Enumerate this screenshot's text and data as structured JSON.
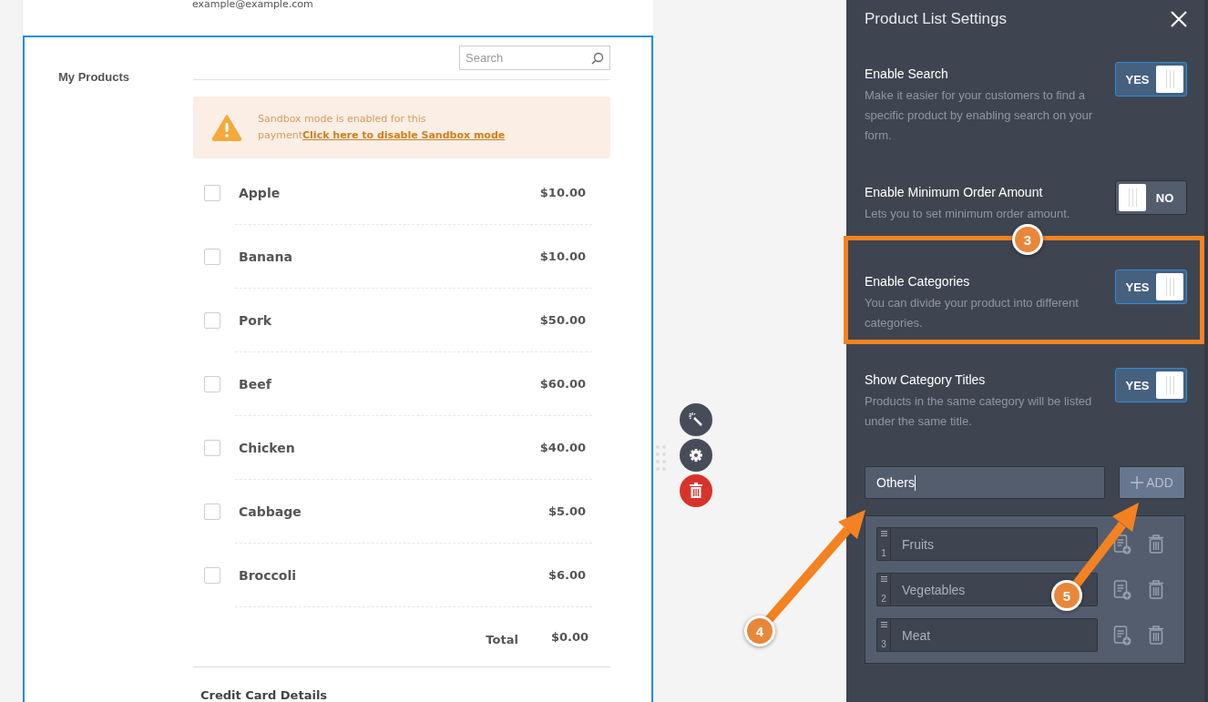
{
  "form": {
    "email": "example@example.com",
    "field_label": "My Products",
    "search": {
      "placeholder": "Search"
    },
    "notice": {
      "text": "Sandbox mode is enabled for this payment",
      "link": "Click here to disable Sandbox mode"
    },
    "products": [
      {
        "name": "Apple",
        "price": "$10.00",
        "checked": false
      },
      {
        "name": "Banana",
        "price": "$10.00",
        "checked": false
      },
      {
        "name": "Pork",
        "price": "$50.00",
        "checked": false
      },
      {
        "name": "Beef",
        "price": "$60.00",
        "checked": false
      },
      {
        "name": "Chicken",
        "price": "$40.00",
        "checked": false
      },
      {
        "name": "Cabbage",
        "price": "$5.00",
        "checked": false
      },
      {
        "name": "Broccoli",
        "price": "$6.00",
        "checked": false
      }
    ],
    "total_label": "Total",
    "total": "$0.00",
    "next_section": "Credit Card Details"
  },
  "settings": {
    "title": "Product List Settings",
    "options": [
      {
        "label": "Enable Search",
        "description": "Make it easier for your customers to find a specific product by enabling search on your form.",
        "toggle_label": "YES",
        "on": true,
        "highlighted": false
      },
      {
        "label": "Enable Minimum Order Amount",
        "description": "Lets you to set minimum order amount.",
        "toggle_label": "NO",
        "on": false,
        "highlighted": false
      },
      {
        "label": "Enable Categories",
        "description": "You can divide your product into different categories.",
        "toggle_label": "YES",
        "on": true,
        "highlighted": true
      },
      {
        "label": "Show Category Titles",
        "description": "Products in the same category will be listed under the same title.",
        "toggle_label": "YES",
        "on": true,
        "highlighted": false
      }
    ],
    "category_input": {
      "value": "Others"
    },
    "add_button": "ADD",
    "categories": [
      {
        "number": "1",
        "name": "Fruits"
      },
      {
        "number": "2",
        "name": "Vegetables"
      },
      {
        "number": "3",
        "name": "Meat"
      }
    ]
  },
  "annotations": [
    {
      "number": "3"
    },
    {
      "number": "4"
    },
    {
      "number": "5"
    }
  ]
}
